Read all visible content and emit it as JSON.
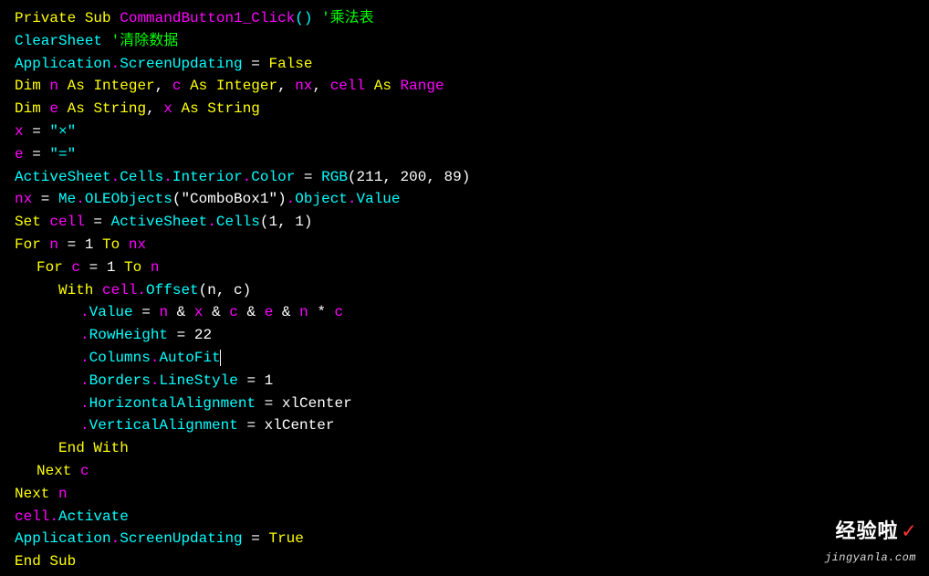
{
  "code": {
    "l1": {
      "privSub": "Private Sub",
      "cmdClick": "CommandButton1_Click",
      "parens": "()",
      "comment": " '乘法表"
    },
    "l2": {
      "clearSheet": "ClearSheet",
      "comment": " '清除数据"
    },
    "l3": {
      "app": "Application",
      "dot1": ".",
      "su": "ScreenUpdating",
      "eq": " = ",
      "false": "False"
    },
    "l4": {
      "dim": "Dim",
      "sp": " ",
      "n": "n",
      "as1": "As Integer",
      "comma1": ", ",
      "c": "c",
      "as2": "As Integer",
      "comma2": ", ",
      "nx": "nx",
      "comma3": ", ",
      "cell": "cell",
      "asrange": "As",
      "sp2": " ",
      "range": "Range"
    },
    "l5": {
      "dim": "Dim",
      "sp": " ",
      "e": "e",
      "as1": "As String",
      "comma": ", ",
      "x": "x",
      "as2": "As String"
    },
    "l6": {
      "x": "x",
      "eq": " = ",
      "str": "\"×\""
    },
    "l7": {
      "e": "e",
      "eq": " = ",
      "str": "\"=\""
    },
    "l8": {
      "as": "ActiveSheet",
      "d1": ".",
      "cells": "Cells",
      "d2": ".",
      "interior": "Interior",
      "d3": ".",
      "color": "Color",
      "eq": " = ",
      "rgb": "RGB",
      "args": "(211, 200, 89)"
    },
    "l9": {
      "nx": "nx",
      "eq": " = ",
      "me": "Me",
      "d1": ".",
      "ole": "OLEObjects",
      "args": "(\"ComboBox1\")",
      "d2": ".",
      "obj": "Object",
      "d3": ".",
      "val": "Value"
    },
    "l10": {
      "set": "Set",
      "sp": " ",
      "cell": "cell",
      "eq": " = ",
      "as": "ActiveSheet",
      "d1": ".",
      "cells": "Cells",
      "args": "(1, 1)"
    },
    "l11": {
      "for": "For",
      "sp": " ",
      "n": "n",
      "eq": " = 1 ",
      "to": "To",
      "sp2": " ",
      "nx": "nx"
    },
    "l12": {
      "for": "For",
      "sp": " ",
      "c": "c",
      "eq": " = 1 ",
      "to": "To",
      "sp2": " ",
      "n": "n"
    },
    "l13": {
      "with": "With",
      "sp": " ",
      "cell": "cell",
      "d1": ".",
      "offset": "Offset",
      "args": "(n, c)"
    },
    "l14": {
      "d": ".",
      "val": "Value",
      "eq": " = ",
      "n": "n",
      "amp1": " & ",
      "x": "x",
      "amp2": " & ",
      "c": "c",
      "amp3": " & ",
      "e": "e",
      "amp4": " & ",
      "n2": "n",
      "star": " * ",
      "c2": "c"
    },
    "l15": {
      "d": ".",
      "rh": "RowHeight",
      "eq": " = 22"
    },
    "l16": {
      "d": ".",
      "cols": "Columns",
      "d2": ".",
      "af": "AutoFit"
    },
    "l17": {
      "d": ".",
      "borders": "Borders",
      "d2": ".",
      "ls": "LineStyle",
      "eq": " = 1"
    },
    "l18": {
      "d": ".",
      "ha": "HorizontalAlignment",
      "eq": " = xlCenter"
    },
    "l19": {
      "d": ".",
      "va": "VerticalAlignment",
      "eq": " = xlCenter"
    },
    "l20": {
      "endwith": "End With"
    },
    "l21": {
      "next": "Next",
      "sp": " ",
      "c": "c"
    },
    "l22": {
      "next": "Next",
      "sp": " ",
      "n": "n"
    },
    "l23": {
      "cell": "cell",
      "d": ".",
      "act": "Activate"
    },
    "l24": {
      "app": "Application",
      "d": ".",
      "su": "ScreenUpdating",
      "eq": " = ",
      "true": "True"
    },
    "l25": {
      "endsub": "End Sub"
    }
  },
  "watermark": {
    "main": "经验啦",
    "sub": "jingyanla.com"
  }
}
